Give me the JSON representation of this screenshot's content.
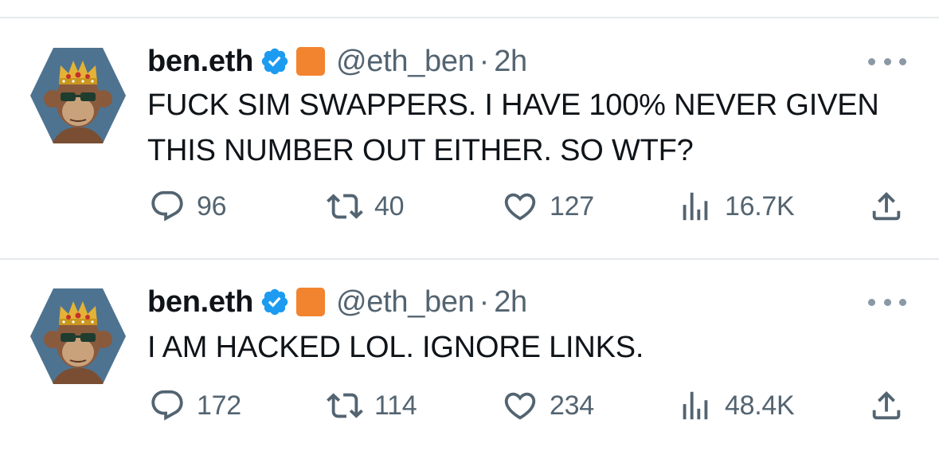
{
  "colors": {
    "verified_badge": "#1d9bf0",
    "emoji_square": "#f28430",
    "secondary_text": "#536471",
    "primary_text": "#0f1419",
    "divider": "#e6e9ec"
  },
  "tweets": [
    {
      "author_name": "ben.eth",
      "verified_icon": "verified-badge-icon",
      "emoji_icon": "orange-square-emoji",
      "handle": "@eth_ben",
      "separator": "·",
      "time": "2h",
      "text": "FUCK SIM SWAPPERS. I HAVE 100% NEVER GIVEN THIS NUMBER OUT EITHER. SO WTF?",
      "replies": "96",
      "retweets": "40",
      "likes": "127",
      "views": "16.7K"
    },
    {
      "author_name": "ben.eth",
      "verified_icon": "verified-badge-icon",
      "emoji_icon": "orange-square-emoji",
      "handle": "@eth_ben",
      "separator": "·",
      "time": "2h",
      "text": "I AM HACKED LOL. IGNORE LINKS.",
      "replies": "172",
      "retweets": "114",
      "likes": "234",
      "views": "48.4K"
    }
  ]
}
